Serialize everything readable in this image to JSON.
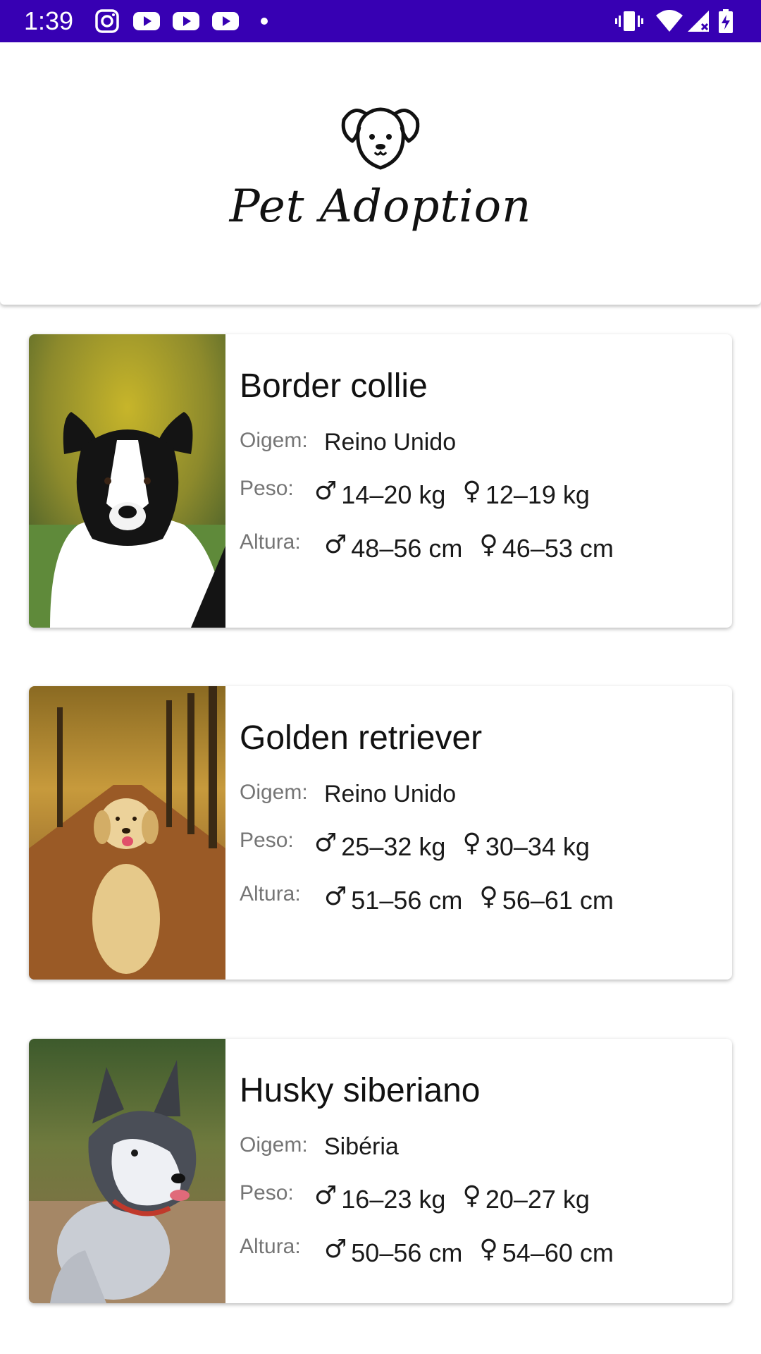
{
  "status_bar": {
    "time": "1:39",
    "icons": [
      "instagram-icon",
      "youtube-icon",
      "youtube-icon",
      "youtube-icon",
      "dot-icon",
      "vibrate-icon",
      "wifi-icon",
      "signal-icon",
      "battery-icon"
    ]
  },
  "header": {
    "logo_icon": "dog-face-icon",
    "app_name": "Pet Adoption"
  },
  "labels": {
    "origin": "Oigem:",
    "weight": "Peso:",
    "height": "Altura:"
  },
  "symbols": {
    "male": "♂",
    "female": "♀"
  },
  "breeds": [
    {
      "name": "Border collie",
      "origin": "Reino Unido",
      "weight_male": "14–20 kg",
      "weight_female": "12–19 kg",
      "height_male": "48–56 cm",
      "height_female": "46–53 cm"
    },
    {
      "name": "Golden retriever",
      "origin": "Reino Unido",
      "weight_male": "25–32 kg",
      "weight_female": "30–34 kg",
      "height_male": "51–56 cm",
      "height_female": "56–61 cm"
    },
    {
      "name": "Husky siberiano",
      "origin": "Sibéria",
      "weight_male": "16–23 kg",
      "weight_female": "20–27 kg",
      "height_male": "50–56 cm",
      "height_female": "54–60 cm"
    }
  ],
  "colors": {
    "status_bar": "#3700b3",
    "background": "#ffffff",
    "label_gray": "#757575",
    "text": "#111111"
  }
}
